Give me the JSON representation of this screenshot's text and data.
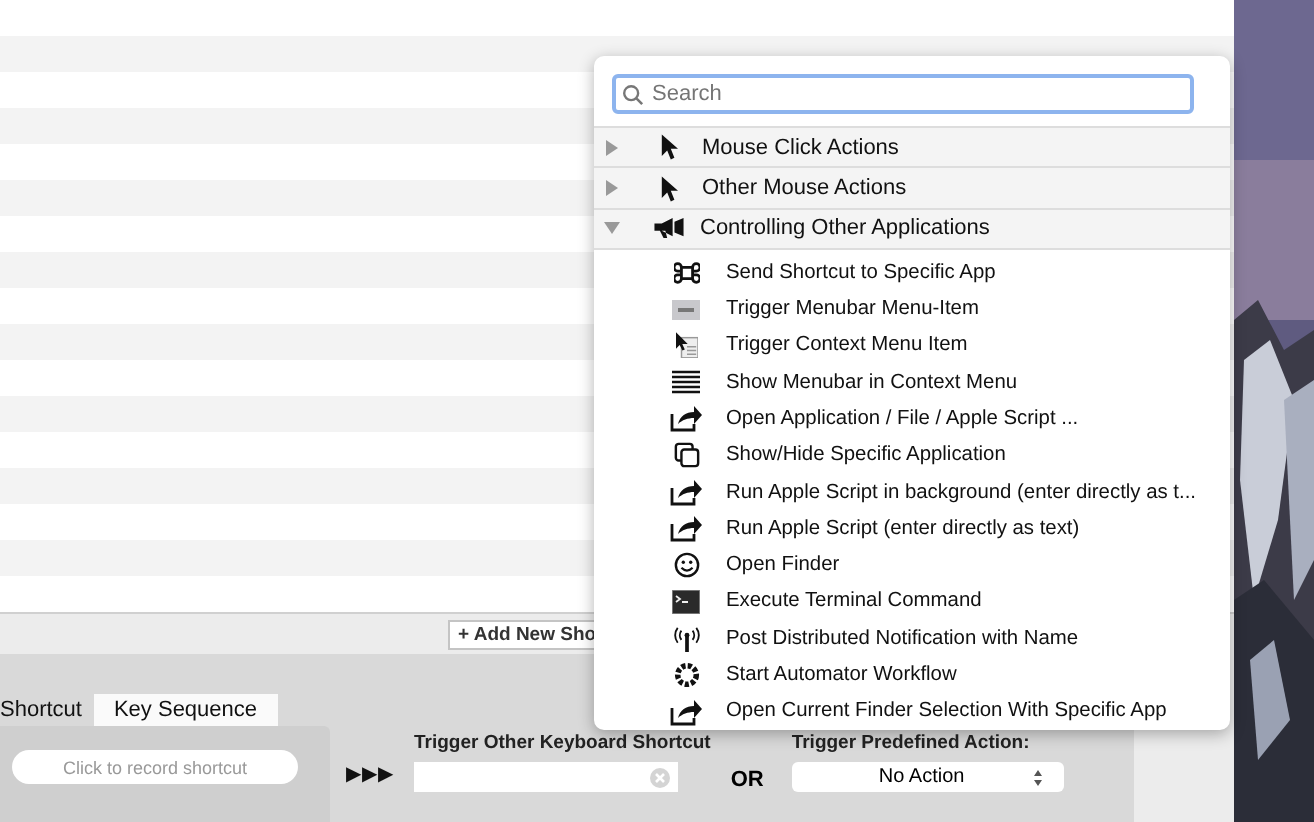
{
  "list": {
    "kind": "striped"
  },
  "add_button": "+ Add New Sho",
  "tabs": [
    {
      "label": "Shortcut",
      "selected": false
    },
    {
      "label": "Key Sequence",
      "selected": true
    }
  ],
  "record_button": "Click to record shortcut",
  "arrows": "▶▶▶",
  "trigger_shortcut": {
    "label": "Trigger Other Keyboard Shortcut"
  },
  "or_label": "OR",
  "predefined": {
    "label": "Trigger Predefined Action:",
    "value": "No Action"
  },
  "popover": {
    "search": {
      "placeholder": "Search"
    },
    "groups": [
      {
        "label": "Mouse Click Actions",
        "expanded": false
      },
      {
        "label": "Other Mouse Actions",
        "expanded": false
      },
      {
        "label": "Controlling Other Applications",
        "expanded": true
      }
    ],
    "items": [
      "Send Shortcut to Specific App",
      "Trigger Menubar Menu-Item",
      "Trigger Context Menu Item",
      "Show Menubar in Context Menu",
      "Open Application / File / Apple Script ...",
      "Show/Hide Specific Application",
      "Run Apple Script in background (enter directly as t...",
      "Run Apple Script (enter directly as text)",
      "Open Finder",
      "Execute Terminal Command",
      "Post Distributed Notification with Name",
      "Start Automator Workflow",
      "Open Current Finder Selection With Specific App"
    ]
  }
}
